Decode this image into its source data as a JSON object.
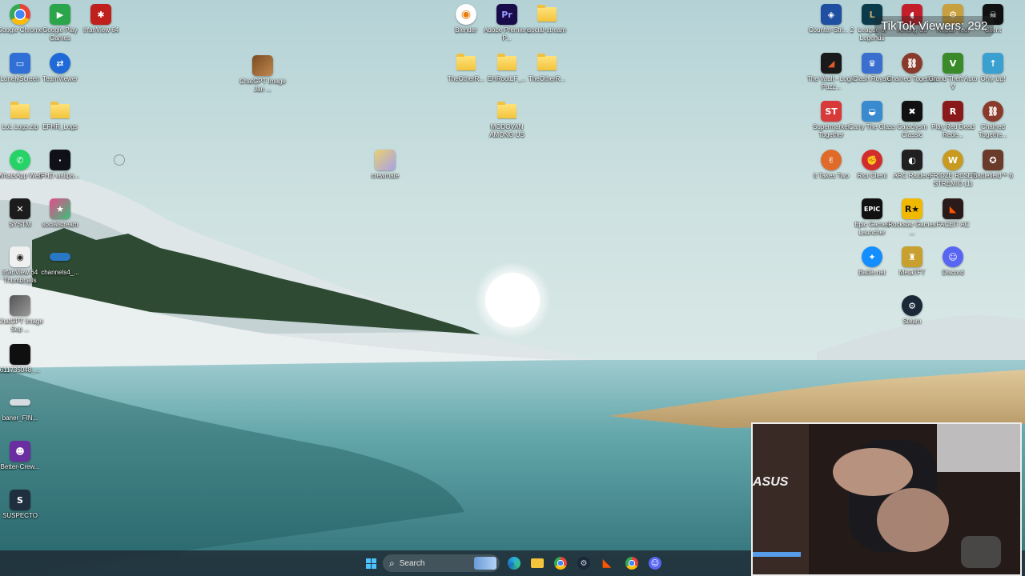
{
  "overlay": {
    "tiktok_viewers": "TikTok Viewers: 292"
  },
  "desktop": {
    "left_icons": [
      {
        "label": "Google Chrome",
        "icon": "chrome-icon",
        "color": "#ffffff"
      },
      {
        "label": "Google Play Games",
        "icon": "play-games-icon",
        "color": "#2aa54a"
      },
      {
        "label": "IrfanView 64",
        "icon": "irfanview-icon",
        "color": "#c0201b"
      },
      {
        "label": "LonelyScreen",
        "icon": "lonelyscreen-icon",
        "color": "#2f6fd6"
      },
      {
        "label": "TeamViewer",
        "icon": "teamviewer-icon",
        "color": "#1f6ad8"
      },
      {
        "label": "LoL Logs.zip",
        "icon": "folder-icon",
        "color": "#f3c43c"
      },
      {
        "label": "EFHR_Logs",
        "icon": "folder-icon",
        "color": "#f3c43c"
      },
      {
        "label": "WhatsApp Web",
        "icon": "whatsapp-icon",
        "color": "#25d366"
      },
      {
        "label": "FHD wallpa...",
        "icon": "image-file-icon",
        "color": "#101018"
      },
      {
        "label": "SYSTM",
        "icon": "systm-icon",
        "color": "#1c1c1c"
      },
      {
        "label": "socialstream",
        "icon": "socialstream-icon",
        "color": "#e64a8c"
      },
      {
        "label": "IrfanView 64 Thumbnails",
        "icon": "irfanview-thumbnails-icon",
        "color": "#2a2a2a"
      },
      {
        "label": "channels4_...",
        "icon": "image-file-icon",
        "color": "#2a77c6"
      },
      {
        "label": "ChatGPT Image Sep ...",
        "icon": "image-file-icon",
        "color": "#444444"
      },
      {
        "label": "611735048_...",
        "icon": "image-file-icon",
        "color": "#0f0f0f"
      },
      {
        "label": "baner_FIN...",
        "icon": "image-file-icon",
        "color": "#d7dce0"
      },
      {
        "label": "Better-Crew...",
        "icon": "better-crew-icon",
        "color": "#6a2ea0"
      },
      {
        "label": "SUSPECTO",
        "icon": "suspecto-icon",
        "color": "#202f3f"
      }
    ],
    "middle_icons": [
      {
        "label": "ChatGPT Image Jan ...",
        "icon": "image-file-icon",
        "color": "#7a4a20"
      },
      {
        "label": "crewmate",
        "icon": "image-file-icon",
        "color": "#e8d070"
      },
      {
        "label": "Blender",
        "icon": "blender-icon",
        "color": "#e87d0d"
      },
      {
        "label": "Adobe Premiere P...",
        "icon": "premiere-icon",
        "color": "#1a0b4a"
      },
      {
        "label": "social-stream",
        "icon": "folder-icon",
        "color": "#f3c43c"
      },
      {
        "label": "TheOtherR...",
        "icon": "folder-icon",
        "color": "#f3c43c"
      },
      {
        "label": "EHRootLF_...",
        "icon": "folder-icon",
        "color": "#f3c43c"
      },
      {
        "label": "TheOtherR...",
        "icon": "folder-icon",
        "color": "#f3c43c"
      },
      {
        "label": "MODOVAN AMONG US",
        "icon": "folder-icon",
        "color": "#f3c43c"
      }
    ],
    "right_icons": [
      {
        "label": "Counter-Stri... 2",
        "icon": "counter-strike-icon",
        "color": "#1e4fa0"
      },
      {
        "label": "League of Legends",
        "icon": "league-icon",
        "color": "#0b3a4a"
      },
      {
        "label": "Among Us",
        "icon": "among-us-icon",
        "color": "#c21f2a"
      },
      {
        "label": "Repair Tool",
        "icon": "repair-tool-icon",
        "color": "#c8a040"
      },
      {
        "label": "Client",
        "icon": "client-icon",
        "color": "#111111"
      },
      {
        "label": "The Vault - Logic Puzz...",
        "icon": "vault-icon",
        "color": "#1a1a1a"
      },
      {
        "label": "Clash Royale",
        "icon": "clash-royale-icon",
        "color": "#3a6fcf"
      },
      {
        "label": "Chained Together",
        "icon": "chained-together-icon",
        "color": "#8a3a2a"
      },
      {
        "label": "Grand Theft Auto V",
        "icon": "gta-icon",
        "color": "#3a8a2a"
      },
      {
        "label": "Only Up!",
        "icon": "only-up-icon",
        "color": "#3aa0d0"
      },
      {
        "label": "Supermarket Together",
        "icon": "supermarket-icon",
        "color": "#d83a3a"
      },
      {
        "label": "Carry The Glass",
        "icon": "carry-glass-icon",
        "color": "#3a8ad0"
      },
      {
        "label": "Cataclysm Classic",
        "icon": "cataclysm-icon",
        "color": "#111111"
      },
      {
        "label": "Play Red Dead Rede...",
        "icon": "red-dead-icon",
        "color": "#8a1a1a"
      },
      {
        "label": "Chained Togethe...",
        "icon": "chained-together-icon",
        "color": "#8a3a2a"
      },
      {
        "label": "It Takes Two",
        "icon": "it-takes-two-icon",
        "color": "#e06a2a"
      },
      {
        "label": "Riot Client",
        "icon": "riot-client-icon",
        "color": "#d32c2c"
      },
      {
        "label": "ARC Raiders",
        "icon": "arc-raiders-icon",
        "color": "#202020"
      },
      {
        "label": "FRIDZE RESET STREMIO (1)",
        "icon": "wow-icon",
        "color": "#c89a20"
      },
      {
        "label": "Battlefield™ 6",
        "icon": "battlefield-icon",
        "color": "#6a3a2a"
      },
      {
        "label": "Epic Games Launcher",
        "icon": "epic-games-icon",
        "color": "#111111"
      },
      {
        "label": "Rockstar Games ...",
        "icon": "rockstar-icon",
        "color": "#f0b800"
      },
      {
        "label": "FACEIT AC",
        "icon": "faceit-icon",
        "color": "#2a1a1a"
      },
      {
        "label": "Battle.net",
        "icon": "battlenet-icon",
        "color": "#148eff"
      },
      {
        "label": "MetaTFT",
        "icon": "metatft-icon",
        "color": "#c8a030"
      },
      {
        "label": "Discord",
        "icon": "discord-icon",
        "color": "#5865f2"
      },
      {
        "label": "Steam",
        "icon": "steam-icon",
        "color": "#1b2838"
      }
    ]
  },
  "taskbar": {
    "search_label": "Search",
    "apps": [
      {
        "name": "start-button",
        "icon": "windows-icon",
        "color": "#4cc2ff"
      },
      {
        "name": "edge-button",
        "icon": "edge-icon",
        "color": "#2bb0d8"
      },
      {
        "name": "file-explorer-button",
        "icon": "folder-icon",
        "color": "#f3c43c"
      },
      {
        "name": "chrome-button",
        "icon": "chrome-icon",
        "color": "#ffffff"
      },
      {
        "name": "steam-button",
        "icon": "steam-icon",
        "color": "#1b2838"
      },
      {
        "name": "faceit-button",
        "icon": "faceit-icon",
        "color": "#2a1a1a"
      },
      {
        "name": "chrome-profile-button",
        "icon": "chrome-icon",
        "color": "#ffffff"
      },
      {
        "name": "discord-button",
        "icon": "discord-icon",
        "color": "#5865f2"
      }
    ]
  },
  "webcam": {
    "brand_text": "ASUS"
  }
}
